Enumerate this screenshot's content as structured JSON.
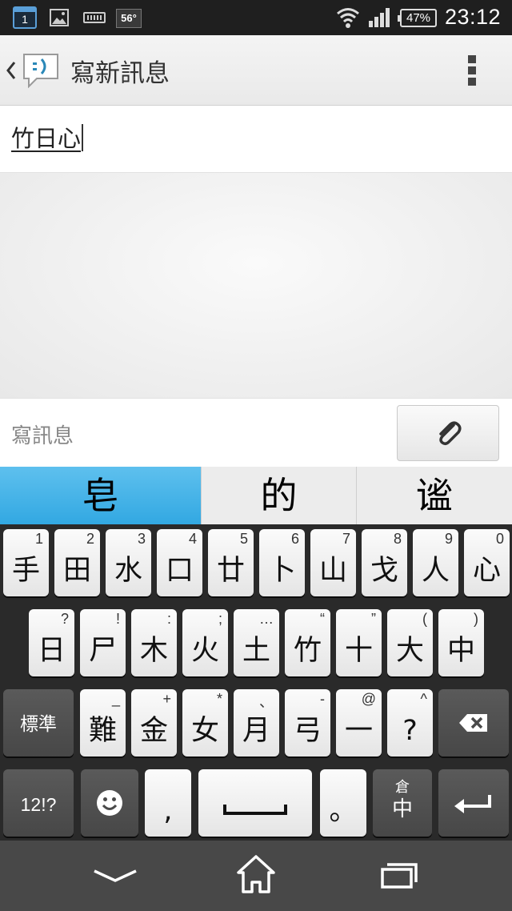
{
  "status_bar": {
    "calendar_day": "1",
    "temperature": "56°",
    "battery": "47%",
    "time": "23:12"
  },
  "action_bar": {
    "title": "寫新訊息",
    "app_icon": "messaging-smiley-icon",
    "back_icon": "chevron-left-icon",
    "menu_icon": "overflow-menu-icon"
  },
  "recipient": {
    "value": "竹日心"
  },
  "compose": {
    "placeholder": "寫訊息",
    "attach_icon": "paperclip-icon"
  },
  "candidates": [
    "皂",
    "的",
    "谧"
  ],
  "keyboard": {
    "row1": [
      {
        "main": "手",
        "sub": "1"
      },
      {
        "main": "田",
        "sub": "2"
      },
      {
        "main": "水",
        "sub": "3"
      },
      {
        "main": "口",
        "sub": "4"
      },
      {
        "main": "廿",
        "sub": "5"
      },
      {
        "main": "卜",
        "sub": "6"
      },
      {
        "main": "山",
        "sub": "7"
      },
      {
        "main": "戈",
        "sub": "8"
      },
      {
        "main": "人",
        "sub": "9"
      },
      {
        "main": "心",
        "sub": "0"
      }
    ],
    "row2": [
      {
        "main": "日",
        "sub": "?"
      },
      {
        "main": "尸",
        "sub": "!"
      },
      {
        "main": "木",
        "sub": ":"
      },
      {
        "main": "火",
        "sub": ";"
      },
      {
        "main": "土",
        "sub": "…"
      },
      {
        "main": "竹",
        "sub": "“"
      },
      {
        "main": "十",
        "sub": "”"
      },
      {
        "main": "大",
        "sub": "("
      },
      {
        "main": "中",
        "sub": ")"
      }
    ],
    "row3": [
      {
        "main": "難",
        "sub": "_"
      },
      {
        "main": "金",
        "sub": "+"
      },
      {
        "main": "女",
        "sub": "*"
      },
      {
        "main": "月",
        "sub": "、"
      },
      {
        "main": "弓",
        "sub": "-"
      },
      {
        "main": "一",
        "sub": "@"
      },
      {
        "main": "?",
        "sub": "^"
      }
    ],
    "standard_label": "標準",
    "symbols_label": "12!?",
    "comma_label": ",",
    "period_label": "。",
    "lang_main": "中",
    "lang_sub": "倉",
    "backspace_icon": "backspace-icon",
    "enter_icon": "enter-icon",
    "emoji_icon": "smiley-icon",
    "space_icon": "space-icon"
  },
  "nav_bar": {
    "back_icon": "nav-back-chevron-icon",
    "home_icon": "home-icon",
    "recent_icon": "recent-apps-icon"
  },
  "colors": {
    "candidate_highlight": "#3fb0e6",
    "keyboard_bg": "#2a2a2a",
    "nav_bg": "#484848"
  }
}
